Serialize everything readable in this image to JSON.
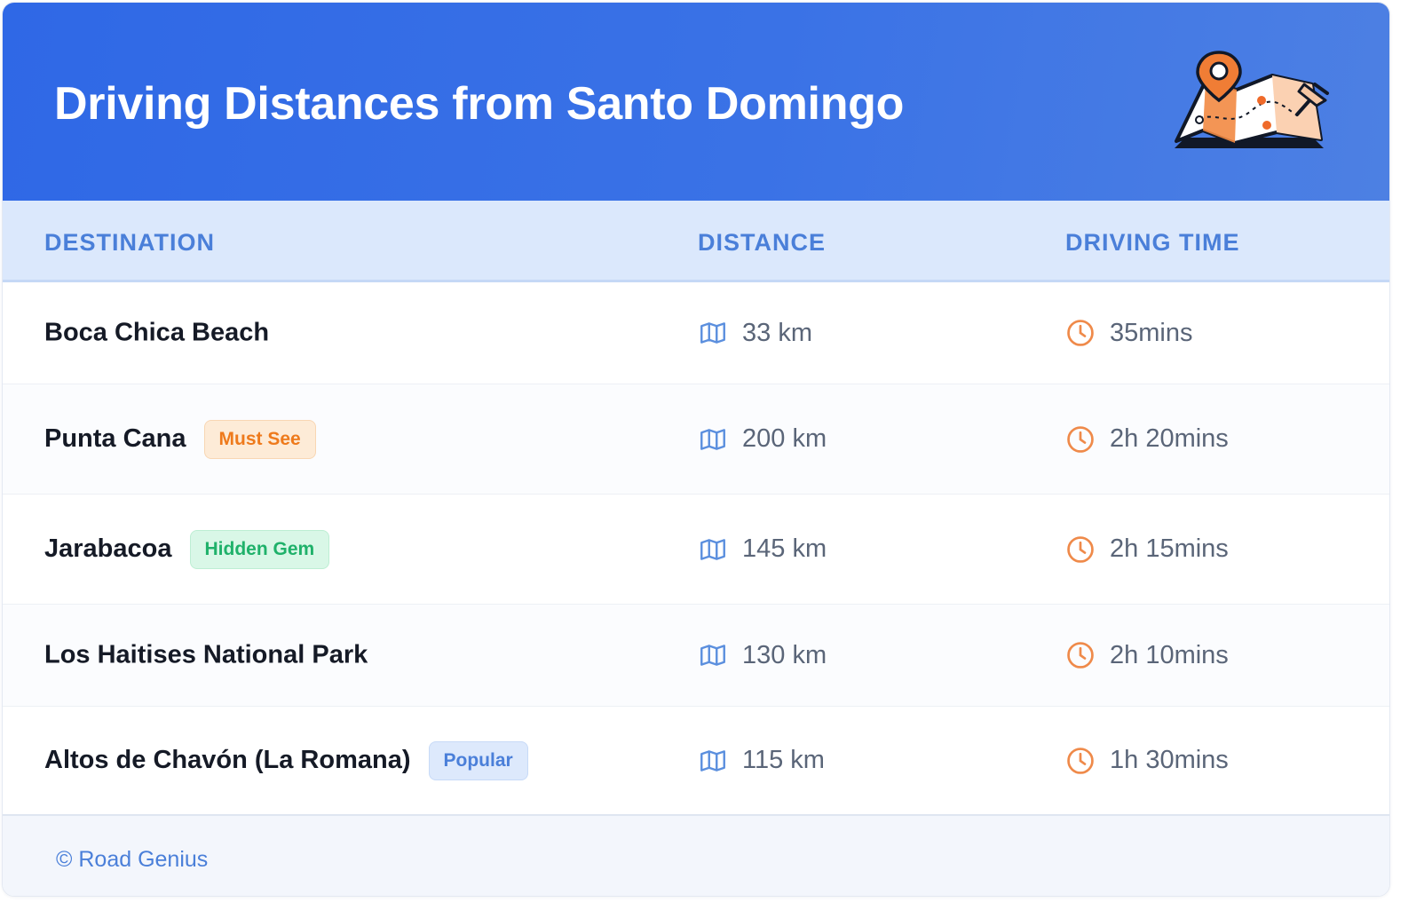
{
  "header": {
    "title": "Driving Distances from Santo Domingo",
    "illustration_icon": "map-pin-illustration"
  },
  "table": {
    "columns": [
      "DESTINATION",
      "DISTANCE",
      "DRIVING TIME"
    ],
    "rows": [
      {
        "destination": "Boca Chica Beach",
        "badge": null,
        "distance": "33 km",
        "time": "35mins"
      },
      {
        "destination": "Punta Cana",
        "badge": "Must See",
        "distance": "200 km",
        "time": "2h 20mins"
      },
      {
        "destination": "Jarabacoa",
        "badge": "Hidden Gem",
        "distance": "145 km",
        "time": "2h 15mins"
      },
      {
        "destination": "Los Haitises National Park",
        "badge": null,
        "distance": "130 km",
        "time": "2h 10mins"
      },
      {
        "destination": "Altos de Chavón (La Romana)",
        "badge": "Popular",
        "distance": "115 km",
        "time": "1h 30mins"
      }
    ],
    "distance_icon": "map-icon",
    "time_icon": "clock-icon"
  },
  "footer": {
    "text": "© Road Genius"
  },
  "colors": {
    "header_bg": "#3570e6",
    "header_row_bg": "#dbe8fc",
    "accent_blue": "#4a7fd9",
    "badge_must_see": "#ee7a1c",
    "badge_hidden_gem": "#1fb16a",
    "badge_popular": "#4a7fd9",
    "clock_icon": "#ef8a4a"
  }
}
